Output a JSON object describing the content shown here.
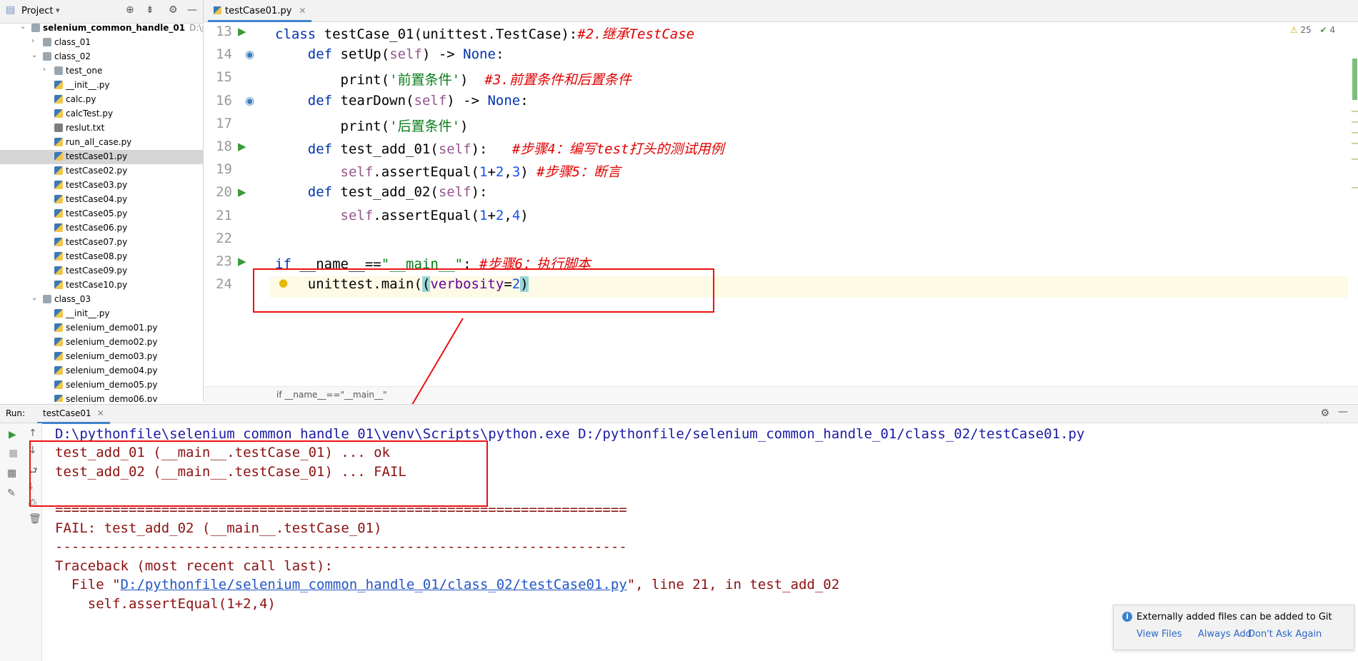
{
  "project": {
    "header_title": "Project",
    "tree": [
      {
        "label": "selenium_common_handle_01",
        "path": "D:\\pytho",
        "type": "folder",
        "level": 0,
        "expanded": true,
        "bold": true
      },
      {
        "label": "class_01",
        "type": "folder",
        "level": 1,
        "expanded": false
      },
      {
        "label": "class_02",
        "type": "folder",
        "level": 1,
        "expanded": true
      },
      {
        "label": "test_one",
        "type": "pkg",
        "level": 2,
        "expanded": false
      },
      {
        "label": "__init__.py",
        "type": "py",
        "level": 2
      },
      {
        "label": "calc.py",
        "type": "py",
        "level": 2
      },
      {
        "label": "calcTest.py",
        "type": "py",
        "level": 2
      },
      {
        "label": "reslut.txt",
        "type": "txt",
        "level": 2
      },
      {
        "label": "run_all_case.py",
        "type": "py",
        "level": 2
      },
      {
        "label": "testCase01.py",
        "type": "py",
        "level": 2,
        "selected": true
      },
      {
        "label": "testCase02.py",
        "type": "py",
        "level": 2
      },
      {
        "label": "testCase03.py",
        "type": "py",
        "level": 2
      },
      {
        "label": "testCase04.py",
        "type": "py",
        "level": 2
      },
      {
        "label": "testCase05.py",
        "type": "py",
        "level": 2
      },
      {
        "label": "testCase06.py",
        "type": "py",
        "level": 2
      },
      {
        "label": "testCase07.py",
        "type": "py",
        "level": 2
      },
      {
        "label": "testCase08.py",
        "type": "py",
        "level": 2
      },
      {
        "label": "testCase09.py",
        "type": "py",
        "level": 2
      },
      {
        "label": "testCase10.py",
        "type": "py",
        "level": 2
      },
      {
        "label": "class_03",
        "type": "folder",
        "level": 1,
        "expanded": true
      },
      {
        "label": "__init__.py",
        "type": "py",
        "level": 2
      },
      {
        "label": "selenium_demo01.py",
        "type": "py",
        "level": 2
      },
      {
        "label": "selenium_demo02.py",
        "type": "py",
        "level": 2
      },
      {
        "label": "selenium_demo03.py",
        "type": "py",
        "level": 2
      },
      {
        "label": "selenium_demo04.py",
        "type": "py",
        "level": 2
      },
      {
        "label": "selenium_demo05.py",
        "type": "py",
        "level": 2
      },
      {
        "label": "selenium_demo06.py",
        "type": "py",
        "level": 2
      }
    ]
  },
  "editor": {
    "tab_label": "testCase01.py",
    "inspections": {
      "warnings": "25",
      "ok": "4"
    },
    "breadcrumb": "if __name__==\"__main__\"",
    "lines": [
      {
        "n": "13",
        "html": "<span class=\"kw\">class</span> testCase_01(unittest.TestCase):<span class=\"cmt\">#2.继承TestCase</span>"
      },
      {
        "n": "14",
        "html": "    <span class=\"kw\">def</span> <span class=\"fn\">setUp</span>(<span class=\"self\">self</span>) -> <span class=\"kw\">None</span>:"
      },
      {
        "n": "15",
        "html": "        print(<span class=\"str\">'前置条件'</span>)  <span class=\"cmt\">#3.前置条件和后置条件</span>"
      },
      {
        "n": "16",
        "html": "    <span class=\"kw\">def</span> <span class=\"fn\">tearDown</span>(<span class=\"self\">self</span>) -> <span class=\"kw\">None</span>:"
      },
      {
        "n": "17",
        "html": "        print(<span class=\"str\">'后置条件'</span>)"
      },
      {
        "n": "18",
        "html": "    <span class=\"kw\">def</span> <span class=\"fn\">test_add_01</span>(<span class=\"self\">self</span>):   <span class=\"cmt\">#步骤4：编写test打头的测试用例</span>"
      },
      {
        "n": "19",
        "html": "        <span class=\"self\">self</span>.assertEqual(<span class=\"num\">1</span>+<span class=\"num\">2</span>,<span class=\"num\">3</span>) <span class=\"cmt\">#步骤5：断言</span>"
      },
      {
        "n": "20",
        "html": "    <span class=\"kw\">def</span> <span class=\"fn\">test_add_02</span>(<span class=\"self\">self</span>):"
      },
      {
        "n": "21",
        "html": "        <span class=\"self\">self</span>.assertEqual(<span class=\"num\">1</span>+<span class=\"num\">2</span>,<span class=\"num\">4</span>)"
      },
      {
        "n": "22",
        "html": ""
      },
      {
        "n": "23",
        "html": "<span class=\"kw\">if</span> __name__==<span class=\"str\">\"__main__\"</span>: <span class=\"cmt\">#步骤6：执行脚本</span>"
      },
      {
        "n": "24",
        "html": "    unittest.main(<span class=\"brace-hl\">(</span><span class=\"param\">verbosity</span>=<span class=\"num\">2</span><span class=\"brace-hl\">)</span>"
      }
    ]
  },
  "run": {
    "label": "Run:",
    "tab_label": "testCase01",
    "output": [
      {
        "cls": "out-path",
        "text": "D:\\pythonfile\\selenium_common_handle_01\\venv\\Scripts\\python.exe D:/pythonfile/selenium_common_handle_01/class_02/testCase01.py"
      },
      {
        "cls": "out-err",
        "text": "test_add_01 (__main__.testCase_01) ... ok"
      },
      {
        "cls": "out-err",
        "text": "test_add_02 (__main__.testCase_01) ... FAIL"
      },
      {
        "cls": "out-err",
        "text": ""
      },
      {
        "cls": "out-err",
        "text": "======================================================================"
      },
      {
        "cls": "out-err",
        "text": "FAIL: test_add_02 (__main__.testCase_01)"
      },
      {
        "cls": "out-err",
        "text": "----------------------------------------------------------------------"
      },
      {
        "cls": "out-err",
        "text": "Traceback (most recent call last):"
      },
      {
        "cls": "out-err",
        "text": "  File \"",
        "link": "D:/pythonfile/selenium_common_handle_01/class_02/testCase01.py",
        "after": "\", line 21, in test_add_02"
      },
      {
        "cls": "out-err",
        "text": "    self.assertEqual(1+2,4)"
      }
    ]
  },
  "notification": {
    "message": "Externally added files can be added to Git",
    "actions": [
      "View Files",
      "Always Add",
      "Don't Ask Again"
    ]
  }
}
